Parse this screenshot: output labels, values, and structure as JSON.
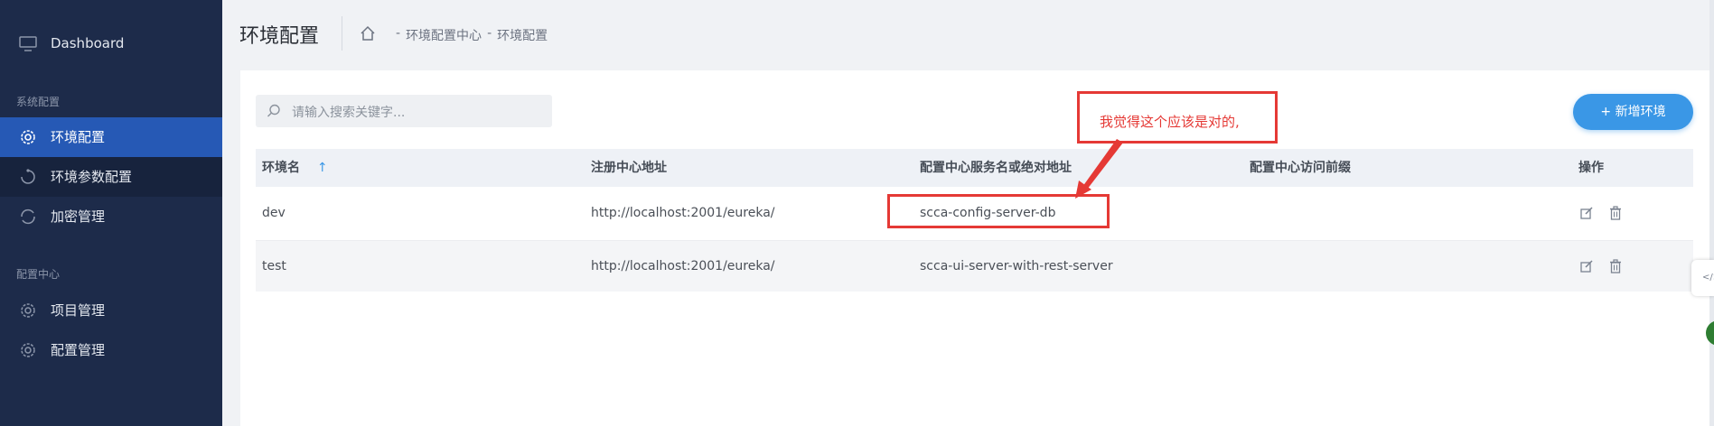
{
  "sidebar": {
    "dashboard": "Dashboard",
    "group_system": "系统配置",
    "group_config": "配置中心",
    "items": [
      {
        "label": "环境配置"
      },
      {
        "label": "环境参数配置"
      },
      {
        "label": "加密管理"
      },
      {
        "label": "项目管理"
      },
      {
        "label": "配置管理"
      }
    ]
  },
  "header": {
    "title": "环境配置",
    "breadcrumb": [
      "-",
      "环境配置中心",
      "-",
      "环境配置"
    ]
  },
  "search": {
    "placeholder": "请输入搜索关键字..."
  },
  "toolbar": {
    "add_label": "+ 新增环境"
  },
  "table": {
    "columns": [
      "环境名",
      "注册中心地址",
      "配置中心服务名或绝对地址",
      "配置中心访问前缀",
      "操作"
    ],
    "sort_icon": "↑",
    "rows": [
      {
        "name": "dev",
        "registry": "http://localhost:2001/eureka/",
        "service": "scca-config-server-db",
        "prefix": ""
      },
      {
        "name": "test",
        "registry": "http://localhost:2001/eureka/",
        "service": "scca-ui-server-with-rest-server",
        "prefix": ""
      }
    ]
  },
  "annotation": {
    "text": "我觉得这个应该是对的,"
  },
  "float_tab": {
    "label": "</>"
  },
  "colors": {
    "sidebar_bg": "#1d2b4a",
    "active_item": "#2659b5",
    "accent": "#3a97e6",
    "annotation": "#e53935"
  }
}
